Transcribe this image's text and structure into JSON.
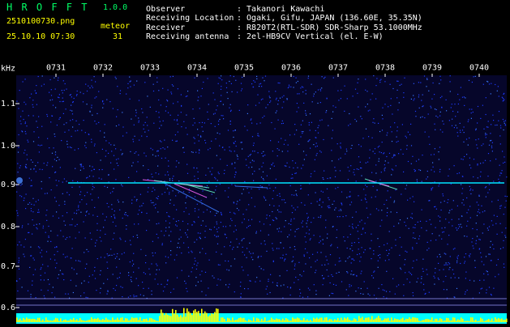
{
  "app": {
    "name": "H R O F F T",
    "version": "1.0.0",
    "filename": "2510100730.png",
    "datetime": "25.10.10 07:30",
    "meteor_label": "meteor",
    "meteor_count": "31"
  },
  "info": {
    "rows": [
      {
        "label": "Observer",
        "value": ": Takanori Kawachi"
      },
      {
        "label": "Receiving Location",
        "value": ": Ogaki, Gifu, JAPAN (136.60E, 35.35N)"
      },
      {
        "label": "Receiver",
        "value": ": R820T2(RTL-SDR) SDR-Sharp 53.1000MHz"
      },
      {
        "label": "Receiving antenna",
        "value": ": 2el-HB9CV Vertical (el. E-W)"
      }
    ]
  },
  "spectrogram": {
    "unit": "kHz",
    "time_ticks": [
      "0731",
      "0732",
      "0733",
      "0734",
      "0735",
      "0736",
      "0737",
      "0738",
      "0739",
      "0740"
    ],
    "freq_ticks": [
      "1.1",
      "1.0",
      "0.9",
      "0.8",
      "0.7",
      "0.6"
    ],
    "background_color": "#0a0a3a",
    "noise_color": "#1e3cff",
    "carrier_color": "#00e6ff",
    "activity_color": "#ffff00",
    "activity_base_color": "#00ffff"
  }
}
